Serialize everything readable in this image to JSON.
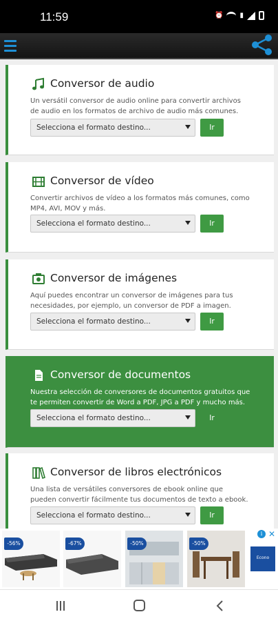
{
  "status_bar": {
    "time": "11:59",
    "icons": [
      "alarm-icon",
      "wifi-icon",
      "volte-icon",
      "signal-icon",
      "battery-icon"
    ]
  },
  "app_bar": {
    "menu_icon": "menu-icon",
    "share_icon": "share-icon",
    "accent_color": "#1e90d6"
  },
  "cards": [
    {
      "title": "Conversor de audio",
      "icon": "music-note-icon",
      "description": "Un versátil conversor de audio online para convertir archivos de audio en los formatos de archivo de audio más comunes.",
      "select_placeholder": "Selecciona el formato destino...",
      "button_label": "Ir",
      "active": false
    },
    {
      "title": "Conversor de vídeo",
      "icon": "film-icon",
      "description": "Convertir archivos de vídeo a los formatos más comunes, como MP4, AVI, MOV y más.",
      "select_placeholder": "Selecciona el formato destino...",
      "button_label": "Ir",
      "active": false
    },
    {
      "title": "Conversor de imágenes",
      "icon": "camera-icon",
      "description": "Aquí puedes encontrar un conversor de imágenes para tus necesidades, por ejemplo, un conversor de PDF a imagen.",
      "select_placeholder": "Selecciona el formato destino...",
      "button_label": "Ir",
      "active": false
    },
    {
      "title": "Conversor de documentos",
      "icon": "document-icon",
      "description": "Nuestra selección de conversores de documentos gratuitos que te permiten convertir de Word a PDF, JPG a PDF y mucho más.",
      "select_placeholder": "Selecciona el formato destino...",
      "button_label": "Ir",
      "active": true
    },
    {
      "title": "Conversor de libros electrónicos",
      "icon": "books-icon",
      "description": "Una lista de versátiles conversores de ebook online que pueden convertir fácilmente tus documentos de texto a ebook.",
      "select_placeholder": "Selecciona el formato destino...",
      "button_label": "Ir",
      "active": false
    }
  ],
  "ad_banner": {
    "items": [
      {
        "badge": "-56%",
        "image": "sectional-sofa-image"
      },
      {
        "badge": "-67%",
        "image": "sectional-sofa-image"
      },
      {
        "badge": "-50%",
        "image": "kitchen-image"
      },
      {
        "badge": "-50%",
        "image": "dining-set-image"
      }
    ],
    "info_label": "i",
    "close_label": "✕",
    "logo_text": "Econo"
  },
  "nav_bar": {
    "icons": [
      "recent-apps-icon",
      "home-icon",
      "back-icon"
    ]
  },
  "colors": {
    "primary_green": "#3c8f40",
    "button_green": "#3f9a43",
    "background": "#efefef"
  }
}
